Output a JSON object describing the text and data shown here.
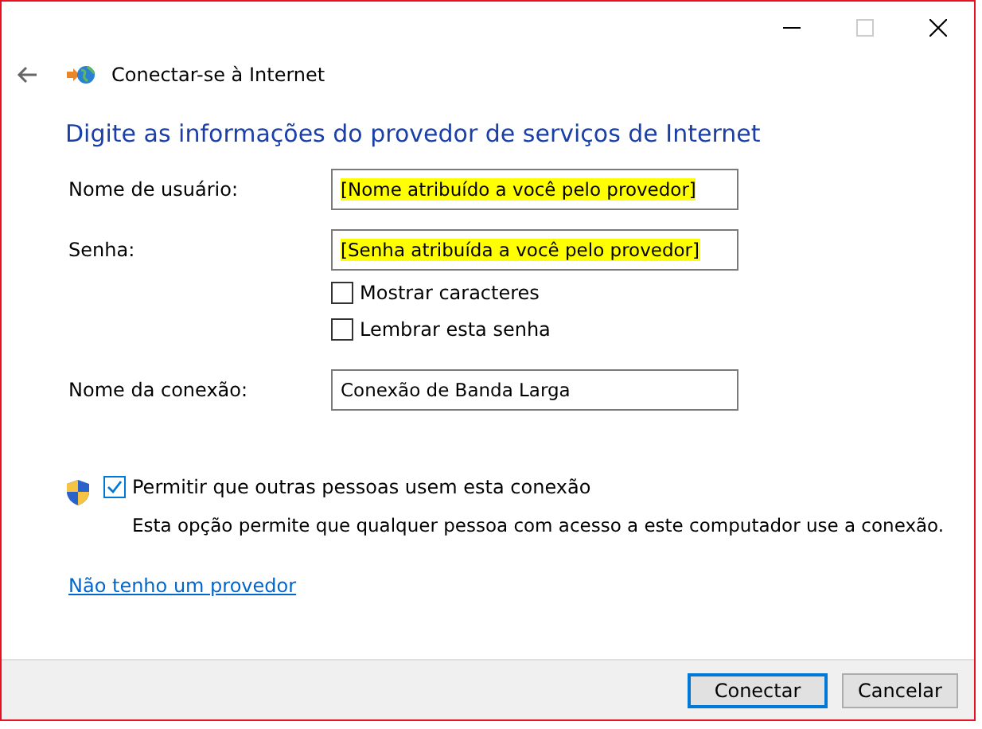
{
  "window": {
    "title": "Conectar-se à Internet"
  },
  "heading": "Digite as informações do provedor de serviços de Internet",
  "fields": [
    {
      "label": "Nome de usuário:",
      "value": "[Nome atribuído a você pelo provedor]",
      "highlighted": true
    },
    {
      "label": "Senha:",
      "value": "[Senha atribuída a você pelo provedor]",
      "highlighted": true
    }
  ],
  "options": [
    {
      "label": "Mostrar caracteres",
      "checked": false
    },
    {
      "label": "Lembrar esta senha",
      "checked": false
    }
  ],
  "connection_name": {
    "label": "Nome da conexão:",
    "value": "Conexão de Banda Larga",
    "highlighted": false
  },
  "allow_others": {
    "label": "Permitir que outras pessoas usem esta conexão",
    "checked": true,
    "description": "Esta opção permite que qualquer pessoa com acesso a este computador use a conexão."
  },
  "link": "Não tenho um provedor",
  "buttons": [
    {
      "label": "Conectar",
      "default": true
    },
    {
      "label": "Cancelar",
      "default": false
    }
  ]
}
